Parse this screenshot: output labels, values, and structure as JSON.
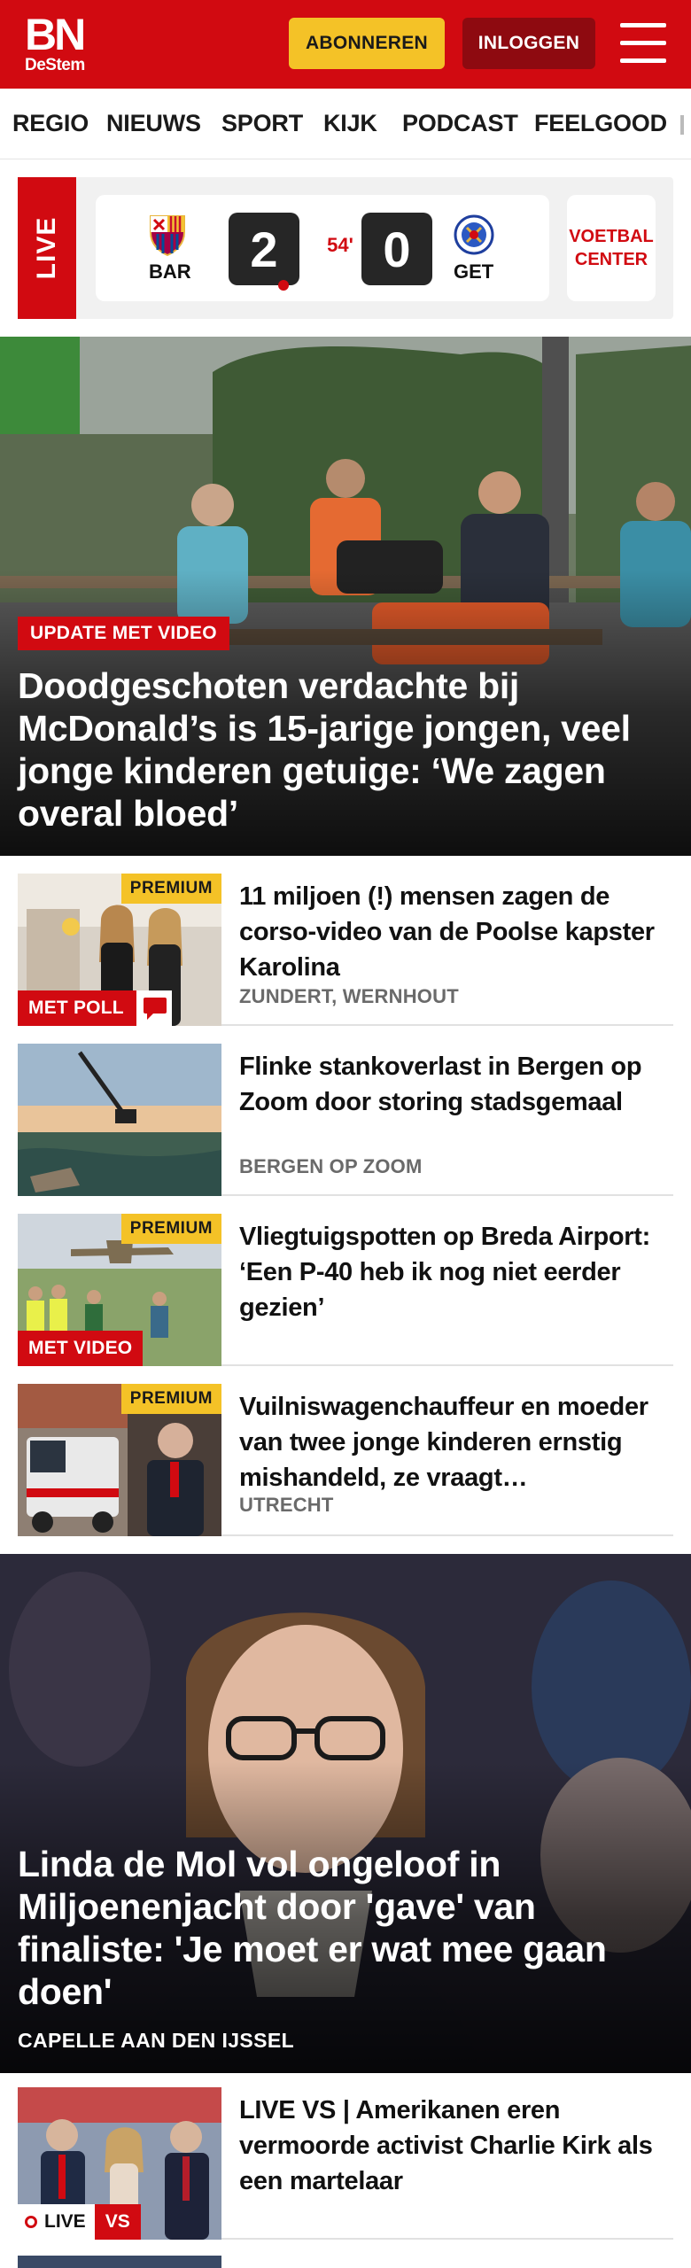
{
  "header": {
    "logo_main": "BN",
    "logo_sub": "DeStem",
    "subscribe_label": "ABONNEREN",
    "login_label": "INLOGGEN",
    "menu_icon": "hamburger-menu-icon"
  },
  "nav": {
    "items": [
      "REGIO",
      "NIEUWS",
      "SPORT",
      "KIJK",
      "PODCAST",
      "FEELGOOD"
    ]
  },
  "live": {
    "label": "LIVE",
    "home_team": "BAR",
    "away_team": "GET",
    "home_score": "2",
    "away_score": "0",
    "minute": "54'",
    "voetbal_center_line1": "VOETBAL",
    "voetbal_center_line2": "CENTER"
  },
  "hero": {
    "badge": "UPDATE MET VIDEO",
    "title": "Doodgeschoten verdachte bij McDonald’s is 15-jarige jongen, veel jonge kinderen getuige: ‘We zagen overal bloed’"
  },
  "articles": [
    {
      "title": "11 miljoen (!) mensen zagen de corso-video van de Poolse kapster Karolina",
      "location": "ZUNDERT, WERNHOUT",
      "premium": "PREMIUM",
      "label": "MET POLL"
    },
    {
      "title": "Flinke stankoverlast in Bergen op Zoom door storing stadsgemaal",
      "location": "BERGEN OP ZOOM"
    },
    {
      "title": "Vliegtuigspotten op Breda Airport: ‘Een P-40 heb ik nog niet eerder gezien’",
      "premium": "PREMIUM",
      "label": "MET VIDEO"
    },
    {
      "title": "Vuilniswagenchauffeur en moeder van twee jonge kinderen ernstig mishandeld, ze vraagt…",
      "location": "UTRECHT",
      "premium": "PREMIUM"
    }
  ],
  "hero2": {
    "title": "Linda de Mol vol ongeloof in Miljoenenjacht door 'gave' van finaliste: 'Je moet er wat mee gaan doen'",
    "location": "CAPELLE AAN DEN IJSSEL"
  },
  "article_live": {
    "title": "LIVE VS | Amerikanen eren vermoorde activist Charlie Kirk als een martelaar",
    "live_label": "LIVE",
    "vs_label": "VS"
  },
  "colors": {
    "brand_red": "#d10a11",
    "premium_yellow": "#f4c227",
    "login_dark_red": "#8e0a10"
  }
}
